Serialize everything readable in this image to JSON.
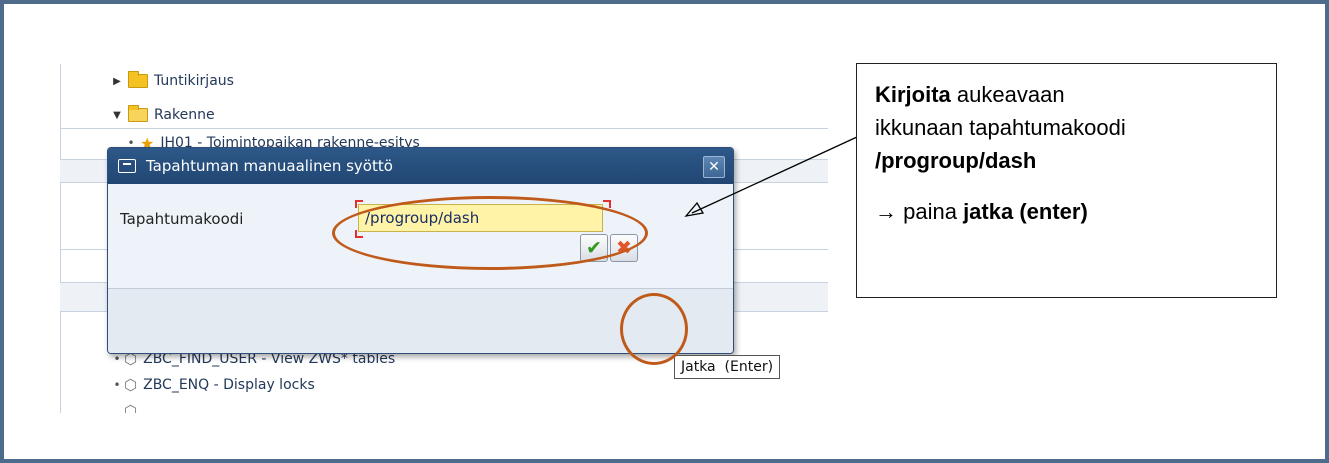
{
  "tree": {
    "item_tuntikirjaus": "Tuntikirjaus",
    "item_rakenne": "Rakenne",
    "item_ih01": "IH01 - Toimintopaikan rakenne-esitys",
    "item_find_user": "ZBC_FIND_USER - View ZWS* tables",
    "item_enq": "ZBC_ENQ - Display locks"
  },
  "dialog": {
    "title": "Tapahtuman manuaalinen syöttö",
    "close_glyph": "✕",
    "field_label": "Tapahtumakoodi",
    "field_value": "/progroup/dash",
    "ok_glyph": "✔",
    "cancel_glyph": "✖"
  },
  "tooltip": {
    "text": "Jatka  (Enter)"
  },
  "note": {
    "bold1": "Kirjoita",
    "line1_rest": " aukeavaan",
    "line2": "ikkunaan tapahtumakoodi",
    "code": "/progroup/dash",
    "arrow": "→",
    "paina": " paina ",
    "jatka": "jatka (enter)"
  },
  "colors": {
    "frame": "#4f6b8c",
    "highlight": "#c05a1a",
    "titlebar": "#214673",
    "input_bg": "#fff3a8"
  }
}
